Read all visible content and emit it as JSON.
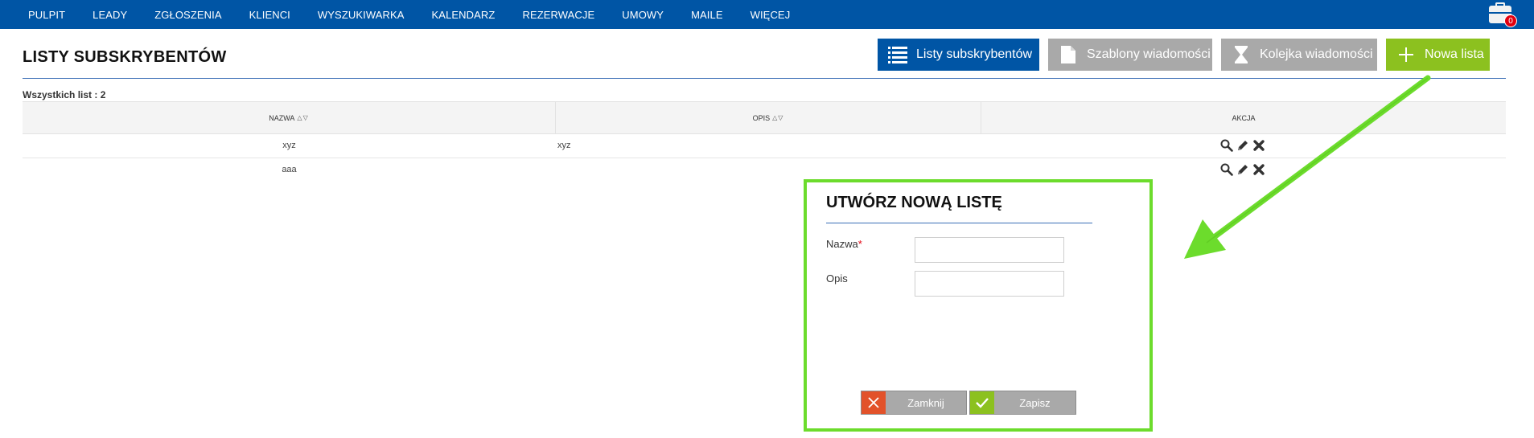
{
  "nav": {
    "items": [
      "PULPIT",
      "LEADY",
      "ZGŁOSZENIA",
      "KLIENCI",
      "WYSZUKIWARKA",
      "KALENDARZ",
      "REZERWACJE",
      "UMOWY",
      "MAILE",
      "WIĘCEJ"
    ],
    "cart_badge": "0"
  },
  "header": {
    "title": "LISTY SUBSKRYBENTÓW",
    "buttons": {
      "lists": "Listy subskrybentów",
      "templates": "Szablony wiadomości",
      "queue": "Kolejka wiadomości",
      "new_list": "Nowa lista"
    }
  },
  "table": {
    "count_label": "Wszystkich list : 2",
    "columns": [
      "NAZWA",
      "OPIS",
      "AKCJA"
    ],
    "rows": [
      {
        "name": "xyz",
        "desc": "xyz"
      },
      {
        "name": "aaa",
        "desc": ""
      }
    ]
  },
  "modal": {
    "title": "UTWÓRZ NOWĄ LISTĘ",
    "name_label": "Nazwa",
    "required_mark": "*",
    "desc_label": "Opis",
    "name_value": "",
    "desc_value": "",
    "close_label": "Zamknij",
    "save_label": "Zapisz"
  },
  "colors": {
    "nav_blue": "#0055a5",
    "accent_green": "#8cc11f",
    "highlight_green": "#6cdc2c",
    "close_red": "#e2522a",
    "gray_button": "#a9a9a9"
  }
}
